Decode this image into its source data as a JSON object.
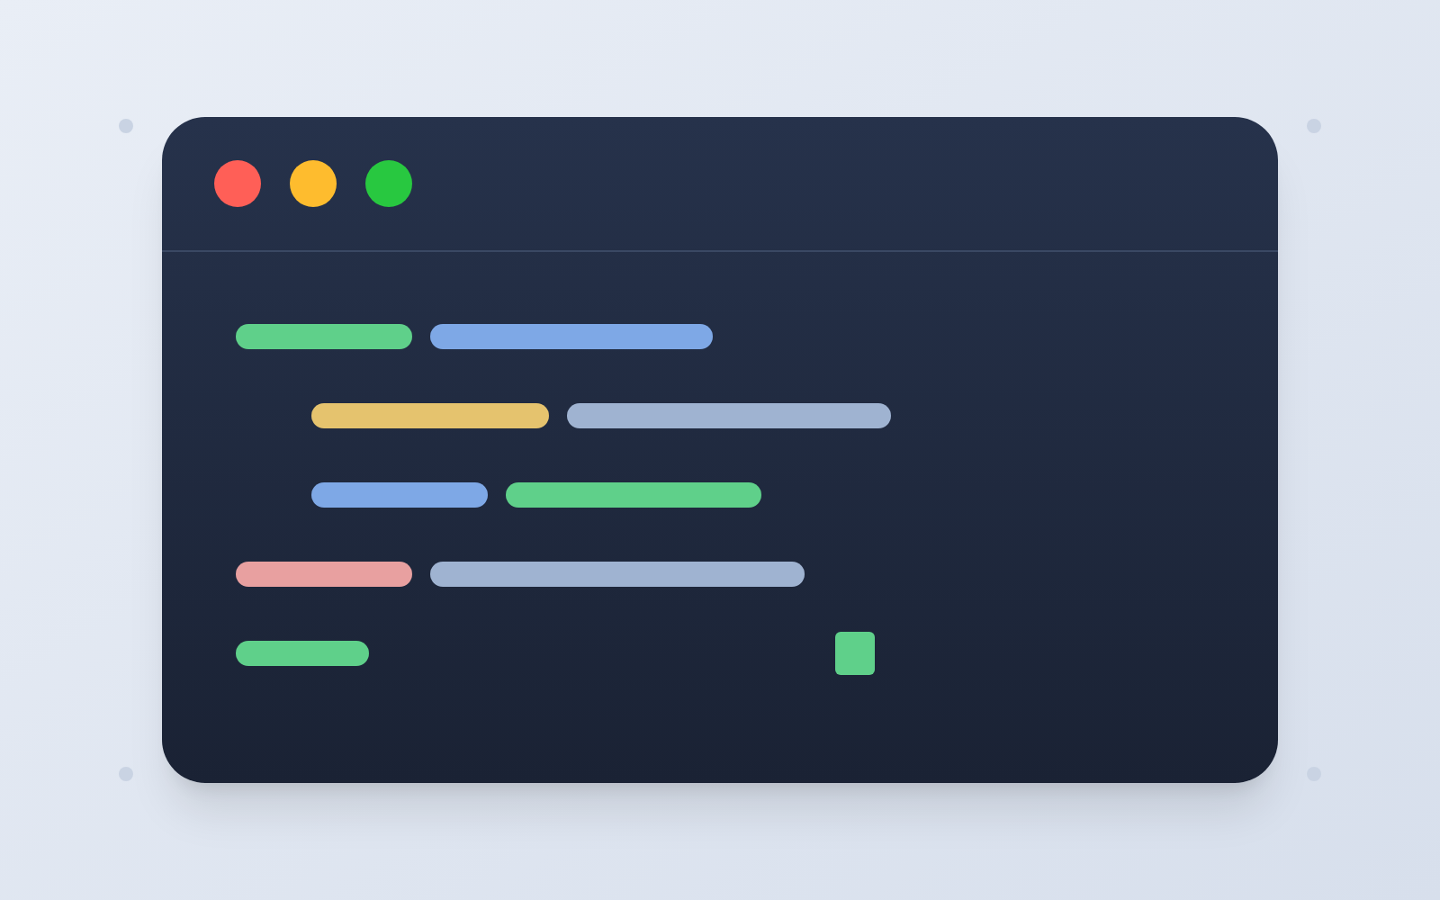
{
  "window": {
    "controls": [
      {
        "color": "#ff5f57"
      },
      {
        "color": "#febc2e"
      },
      {
        "color": "#28c840"
      }
    ]
  },
  "code_lines": [
    {
      "segments": [
        {
          "color": "#5fd08a"
        },
        {
          "color": "#7ea8e6"
        }
      ],
      "children": [
        {
          "segments": [
            {
              "color": "#e5c36e"
            },
            {
              "color": "#9fb3d1"
            }
          ]
        },
        {
          "segments": [
            {
              "color": "#7ea8e6"
            },
            {
              "color": "#5fd08a"
            }
          ]
        }
      ]
    },
    {
      "segments": [
        {
          "color": "#e8a0a0"
        },
        {
          "color": "#9fb3d1"
        }
      ]
    },
    {
      "segments": [
        {
          "color": "#5fd08a"
        }
      ],
      "cursor": true
    }
  ]
}
